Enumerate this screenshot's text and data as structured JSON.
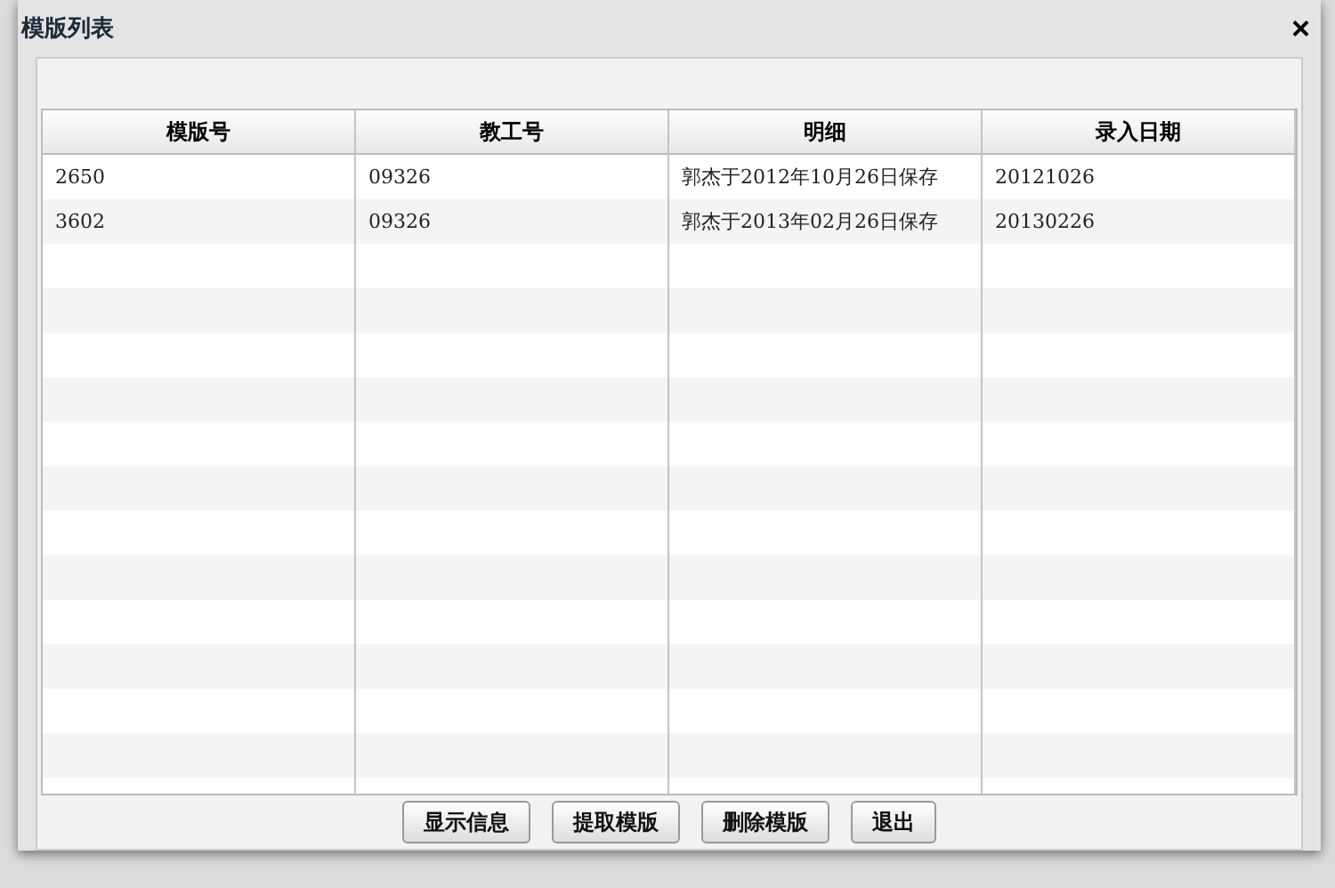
{
  "dialog": {
    "title": "模版列表",
    "close": "×"
  },
  "table": {
    "columns": [
      "模版号",
      "教工号",
      "明细",
      "录入日期"
    ],
    "rows": [
      {
        "cells": [
          "2650",
          "09326",
          "郭杰于2012年10月26日保存",
          "20121026"
        ]
      },
      {
        "cells": [
          "3602",
          "09326",
          "郭杰于2013年02月26日保存",
          "20130226"
        ]
      }
    ]
  },
  "buttons": [
    "显示信息",
    "提取模版",
    "删除模版",
    "退出"
  ]
}
